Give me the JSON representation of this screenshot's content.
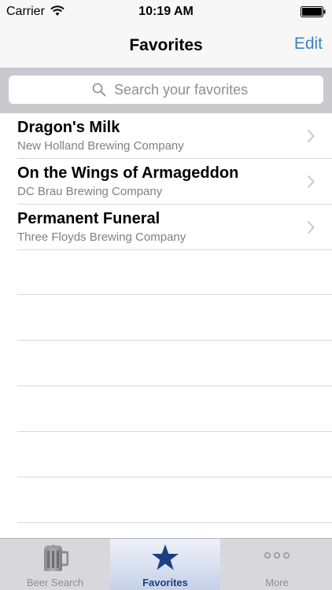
{
  "status_bar": {
    "carrier": "Carrier",
    "time": "10:19 AM"
  },
  "nav_bar": {
    "title": "Favorites",
    "edit_label": "Edit"
  },
  "search": {
    "placeholder": "Search your favorites"
  },
  "favorites": [
    {
      "name": "Dragon's Milk",
      "brewery": "New Holland Brewing Company"
    },
    {
      "name": "On the Wings of Armageddon",
      "brewery": "DC Brau Brewing Company"
    },
    {
      "name": "Permanent Funeral",
      "brewery": "Three Floyds Brewing Company"
    }
  ],
  "tabs": [
    {
      "label": "Beer Search",
      "icon": "beer-mug-icon",
      "active": false
    },
    {
      "label": "Favorites",
      "icon": "star-icon",
      "active": true
    },
    {
      "label": "More",
      "icon": "more-dots-icon",
      "active": false
    }
  ],
  "colors": {
    "accent": "#3b82c8",
    "active_tab": "#1b3f84",
    "search_bar_bg": "#c9c9ce"
  }
}
